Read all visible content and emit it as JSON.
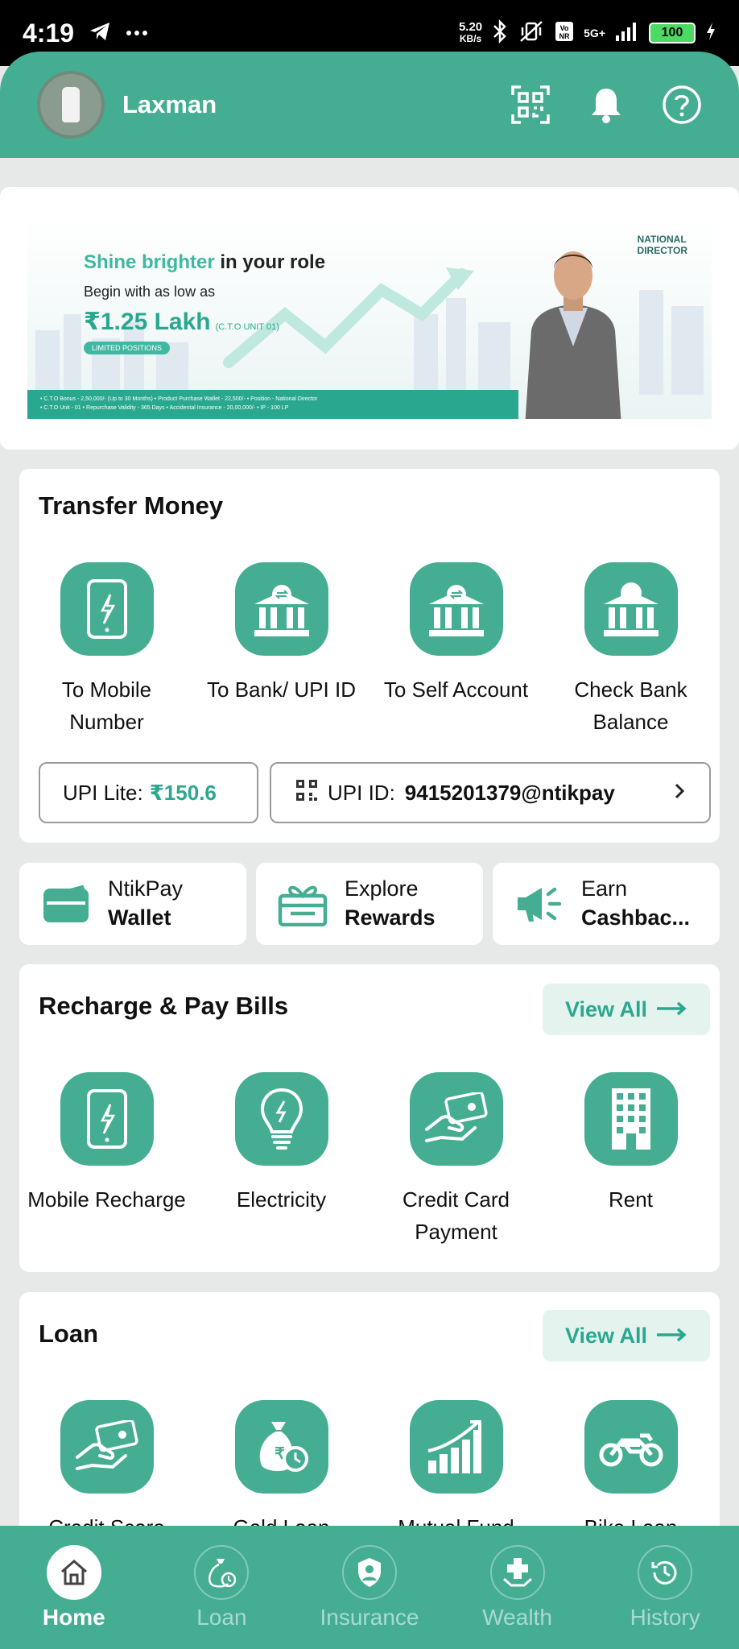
{
  "status_bar": {
    "time": "4:19",
    "net_speed_value": "5.20",
    "net_speed_unit": "KB/s",
    "network": "5G+",
    "battery": "100"
  },
  "header": {
    "user_name": "Laxman"
  },
  "banner": {
    "headline_accent": "Shine brighter",
    "headline_rest": " in your role",
    "subline": "Begin with as low as",
    "price": "₹1.25 Lakh",
    "price_note": "(C.T.O UNIT 01)",
    "badge": "LIMITED POSITIONS",
    "role_line1": "NATIONAL",
    "role_line2": "DIRECTOR",
    "strip_line1": "• C.T.O Bonus - 2,50,000/- (Up to 30 Months)   • Product Purchase Wallet - 22,500/-   • Position - National Director",
    "strip_line2": "• C.T.O Unit - 01   • Repurchase Validity - 365 Days   • Accidental Insurance - 20,00,000/-   • IP - 100 LP"
  },
  "transfer": {
    "title": "Transfer Money",
    "items": [
      {
        "label": "To Mobile Number",
        "icon": "mobile-icon"
      },
      {
        "label": "To Bank/ UPI ID",
        "icon": "bank-transfer-icon"
      },
      {
        "label": "To Self Account",
        "icon": "self-transfer-icon"
      },
      {
        "label": "Check Bank Balance",
        "icon": "bank-balance-icon"
      }
    ],
    "upi_lite_label": "UPI Lite:",
    "upi_lite_amount": "₹150.6",
    "upi_id_label": "UPI ID:",
    "upi_id_value": "9415201379@ntikpay"
  },
  "quick": [
    {
      "top": "NtikPay",
      "bottom": "Wallet",
      "icon": "wallet-icon"
    },
    {
      "top": "Explore",
      "bottom": "Rewards",
      "icon": "gift-icon"
    },
    {
      "top": "Earn",
      "bottom": "Cashbac...",
      "icon": "megaphone-icon"
    }
  ],
  "recharge": {
    "title": "Recharge & Pay Bills",
    "view_all": "View All",
    "items": [
      {
        "label": "Mobile Recharge",
        "icon": "mobile-icon"
      },
      {
        "label": "Electricity",
        "icon": "bulb-icon"
      },
      {
        "label": "Credit Card Payment",
        "icon": "card-hand-icon"
      },
      {
        "label": "Rent",
        "icon": "building-icon"
      }
    ]
  },
  "loan": {
    "title": "Loan",
    "view_all": "View All",
    "items": [
      {
        "label": "Credit Score",
        "icon": "card-hand-icon"
      },
      {
        "label": "Gold Loan",
        "icon": "money-bag-icon"
      },
      {
        "label": "Mutual Fund",
        "icon": "growth-chart-icon"
      },
      {
        "label": "Bike Loan",
        "icon": "bike-icon"
      }
    ]
  },
  "bottom_nav": [
    {
      "label": "Home",
      "icon": "home-icon",
      "active": true
    },
    {
      "label": "Loan",
      "icon": "loan-bag-icon",
      "active": false
    },
    {
      "label": "Insurance",
      "icon": "shield-user-icon",
      "active": false
    },
    {
      "label": "Wealth",
      "icon": "medical-hand-icon",
      "active": false
    },
    {
      "label": "History",
      "icon": "history-icon",
      "active": false
    }
  ],
  "colors": {
    "brand": "#44ad92",
    "accent_text": "#2aa88f",
    "page_bg": "#e6e9e8"
  }
}
